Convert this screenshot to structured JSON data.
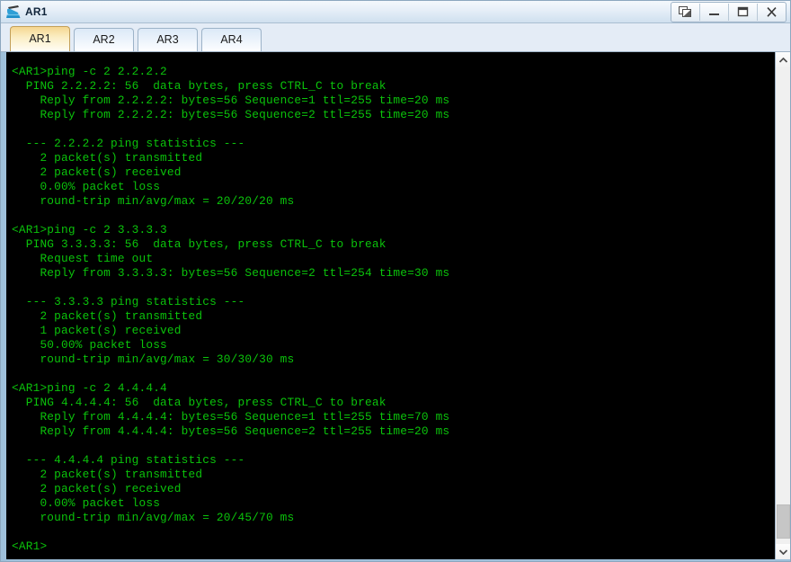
{
  "window": {
    "title": "AR1",
    "icon": "router-device-icon",
    "controls": [
      {
        "name": "restore-windows-button",
        "icon": "cascade-windows-icon",
        "label": ""
      },
      {
        "name": "minimize-button",
        "icon": "minimize-icon",
        "label": ""
      },
      {
        "name": "maximize-button",
        "icon": "maximize-icon",
        "label": ""
      },
      {
        "name": "close-button",
        "icon": "close-icon",
        "label": "X"
      }
    ]
  },
  "tabs": [
    {
      "label": "AR1",
      "active": true
    },
    {
      "label": "AR2",
      "active": false
    },
    {
      "label": "AR3",
      "active": false
    },
    {
      "label": "AR4",
      "active": false
    }
  ],
  "terminal": {
    "text_color": "#0bc30b",
    "background_color": "#000000",
    "lines": [
      "<AR1>ping -c 2 2.2.2.2",
      "  PING 2.2.2.2: 56  data bytes, press CTRL_C to break",
      "    Reply from 2.2.2.2: bytes=56 Sequence=1 ttl=255 time=20 ms",
      "    Reply from 2.2.2.2: bytes=56 Sequence=2 ttl=255 time=20 ms",
      "",
      "  --- 2.2.2.2 ping statistics ---",
      "    2 packet(s) transmitted",
      "    2 packet(s) received",
      "    0.00% packet loss",
      "    round-trip min/avg/max = 20/20/20 ms",
      "",
      "<AR1>ping -c 2 3.3.3.3",
      "  PING 3.3.3.3: 56  data bytes, press CTRL_C to break",
      "    Request time out",
      "    Reply from 3.3.3.3: bytes=56 Sequence=2 ttl=254 time=30 ms",
      "",
      "  --- 3.3.3.3 ping statistics ---",
      "    2 packet(s) transmitted",
      "    1 packet(s) received",
      "    50.00% packet loss",
      "    round-trip min/avg/max = 30/30/30 ms",
      "",
      "<AR1>ping -c 2 4.4.4.4",
      "  PING 4.4.4.4: 56  data bytes, press CTRL_C to break",
      "    Reply from 4.4.4.4: bytes=56 Sequence=1 ttl=255 time=70 ms",
      "    Reply from 4.4.4.4: bytes=56 Sequence=2 ttl=255 time=20 ms",
      "",
      "  --- 4.4.4.4 ping statistics ---",
      "    2 packet(s) transmitted",
      "    2 packet(s) received",
      "    0.00% packet loss",
      "    round-trip min/avg/max = 20/45/70 ms",
      "",
      "<AR1>"
    ]
  },
  "scrollbar": {
    "up_arrow": "chevron-up-icon",
    "down_arrow": "chevron-down-icon",
    "thumb_position": "bottom"
  }
}
